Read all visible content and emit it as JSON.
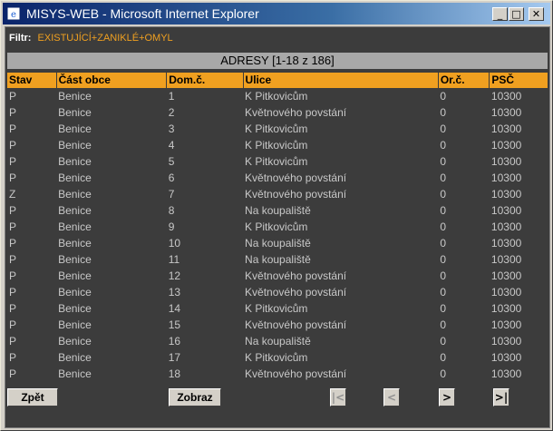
{
  "window": {
    "title": "MISYS-WEB - Microsoft Internet Explorer",
    "min_glyph": "_",
    "max_glyph": "□",
    "close_glyph": "✕"
  },
  "filter": {
    "label": "Filtr:",
    "value": "EXISTUJÍCÍ+ZANIKLÉ+OMYL"
  },
  "section_title": "ADRESY [1-18 z 186]",
  "table": {
    "headers": [
      "Stav",
      "Část obce",
      "Dom.č.",
      "Ulice",
      "Or.č.",
      "PSČ"
    ],
    "rows": [
      [
        "P",
        "Benice",
        "1",
        "K Pitkovicům",
        "0",
        "10300"
      ],
      [
        "P",
        "Benice",
        "2",
        "Květnového povstání",
        "0",
        "10300"
      ],
      [
        "P",
        "Benice",
        "3",
        "K Pitkovicům",
        "0",
        "10300"
      ],
      [
        "P",
        "Benice",
        "4",
        "K Pitkovicům",
        "0",
        "10300"
      ],
      [
        "P",
        "Benice",
        "5",
        "K Pitkovicům",
        "0",
        "10300"
      ],
      [
        "P",
        "Benice",
        "6",
        "Květnového povstání",
        "0",
        "10300"
      ],
      [
        "Z",
        "Benice",
        "7",
        "Květnového povstání",
        "0",
        "10300"
      ],
      [
        "P",
        "Benice",
        "8",
        "Na koupaliště",
        "0",
        "10300"
      ],
      [
        "P",
        "Benice",
        "9",
        "K Pitkovicům",
        "0",
        "10300"
      ],
      [
        "P",
        "Benice",
        "10",
        "Na koupaliště",
        "0",
        "10300"
      ],
      [
        "P",
        "Benice",
        "11",
        "Na koupaliště",
        "0",
        "10300"
      ],
      [
        "P",
        "Benice",
        "12",
        "Květnového povstání",
        "0",
        "10300"
      ],
      [
        "P",
        "Benice",
        "13",
        "Květnového povstání",
        "0",
        "10300"
      ],
      [
        "P",
        "Benice",
        "14",
        "K Pitkovicům",
        "0",
        "10300"
      ],
      [
        "P",
        "Benice",
        "15",
        "Květnového povstání",
        "0",
        "10300"
      ],
      [
        "P",
        "Benice",
        "16",
        "Na koupaliště",
        "0",
        "10300"
      ],
      [
        "P",
        "Benice",
        "17",
        "K Pitkovicům",
        "0",
        "10300"
      ],
      [
        "P",
        "Benice",
        "18",
        "Květnového povstání",
        "0",
        "10300"
      ]
    ]
  },
  "buttons": {
    "back": "Zpět",
    "show": "Zobraz",
    "first": "|<",
    "prev": "<",
    "next": ">",
    "last": ">|"
  },
  "colors": {
    "background": "#3c3c3c",
    "header_accent": "#f0a020",
    "title_bar": "#a8a8a8",
    "text": "#c8c8c8"
  }
}
